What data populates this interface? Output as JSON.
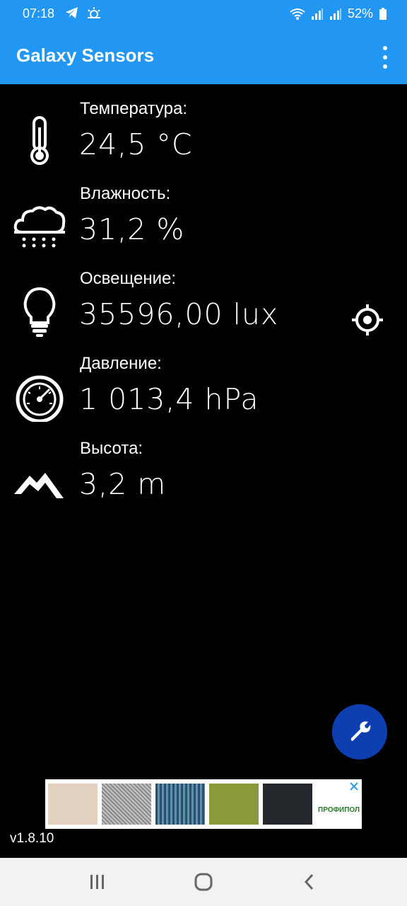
{
  "status_bar": {
    "time": "07:18",
    "battery": "52%",
    "icons_left": [
      "telegram-icon",
      "weather-icon"
    ],
    "icons_right": [
      "wifi-icon",
      "signal-icon",
      "signal-icon",
      "battery-icon"
    ]
  },
  "app_bar": {
    "title": "Galaxy Sensors",
    "menu_icon": "more-vert-icon"
  },
  "sensors": [
    {
      "label": "Температура:",
      "value": "24,5 °C",
      "icon": "thermometer-icon"
    },
    {
      "label": "Влажность:",
      "value": "31,2 %",
      "icon": "rain-cloud-icon"
    },
    {
      "label": "Освещение:",
      "value": "35596,00 lux",
      "icon": "lightbulb-icon"
    },
    {
      "label": "Давление:",
      "value": "1 013,4 hPa",
      "icon": "gauge-icon"
    },
    {
      "label": "Высота:",
      "value": "3,2 m",
      "icon": "mountain-icon"
    }
  ],
  "target_icon": "target-icon",
  "fab_icon": "wrench-icon",
  "ad": {
    "brand": "ПРОФИПОЛ"
  },
  "version": "v1.8.10",
  "colors": {
    "primary": "#2196f3",
    "fab": "#0d3fb0",
    "background": "#000000"
  }
}
